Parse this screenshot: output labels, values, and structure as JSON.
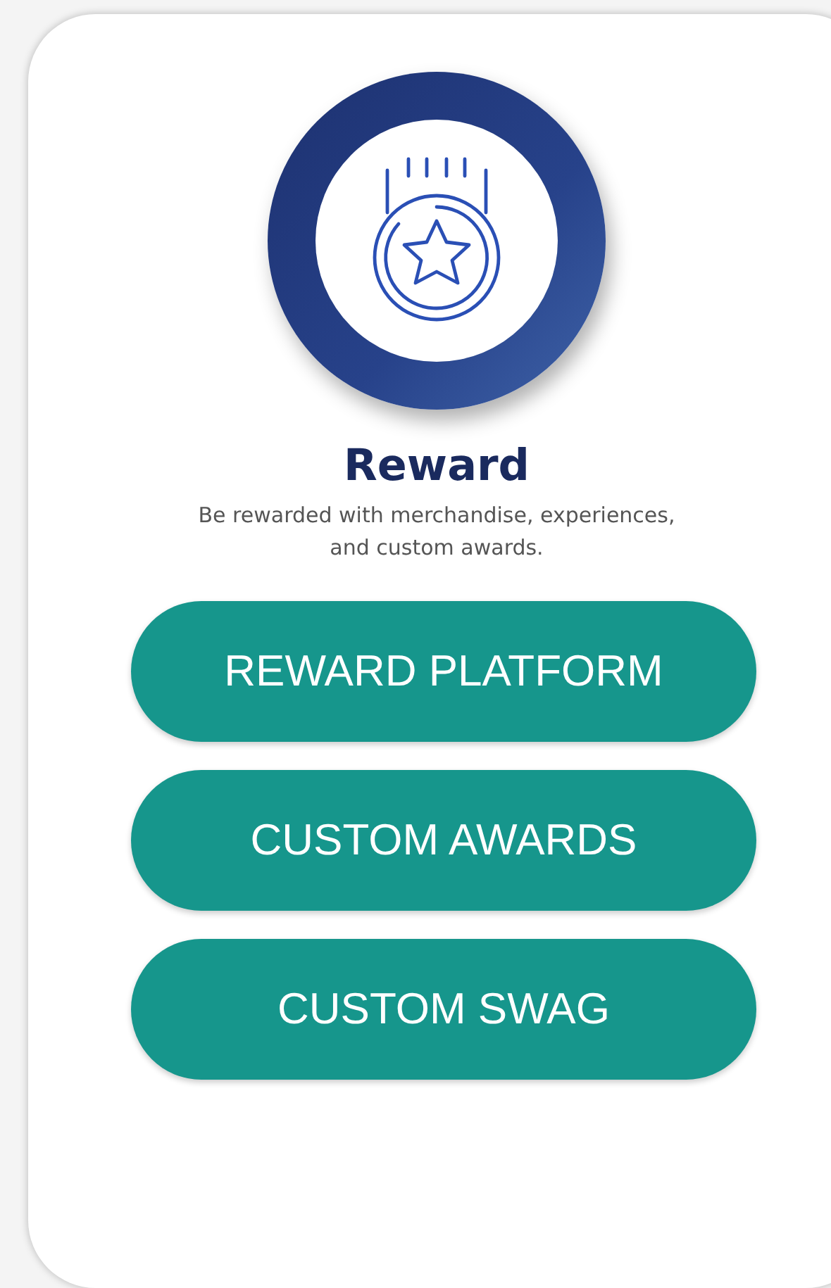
{
  "title": "Reward",
  "description": "Be rewarded with merchandise, experiences, and custom awards.",
  "buttons": [
    {
      "label": "REWARD PLATFORM"
    },
    {
      "label": "CUSTOM AWARDS"
    },
    {
      "label": "CUSTOM SWAG"
    }
  ]
}
